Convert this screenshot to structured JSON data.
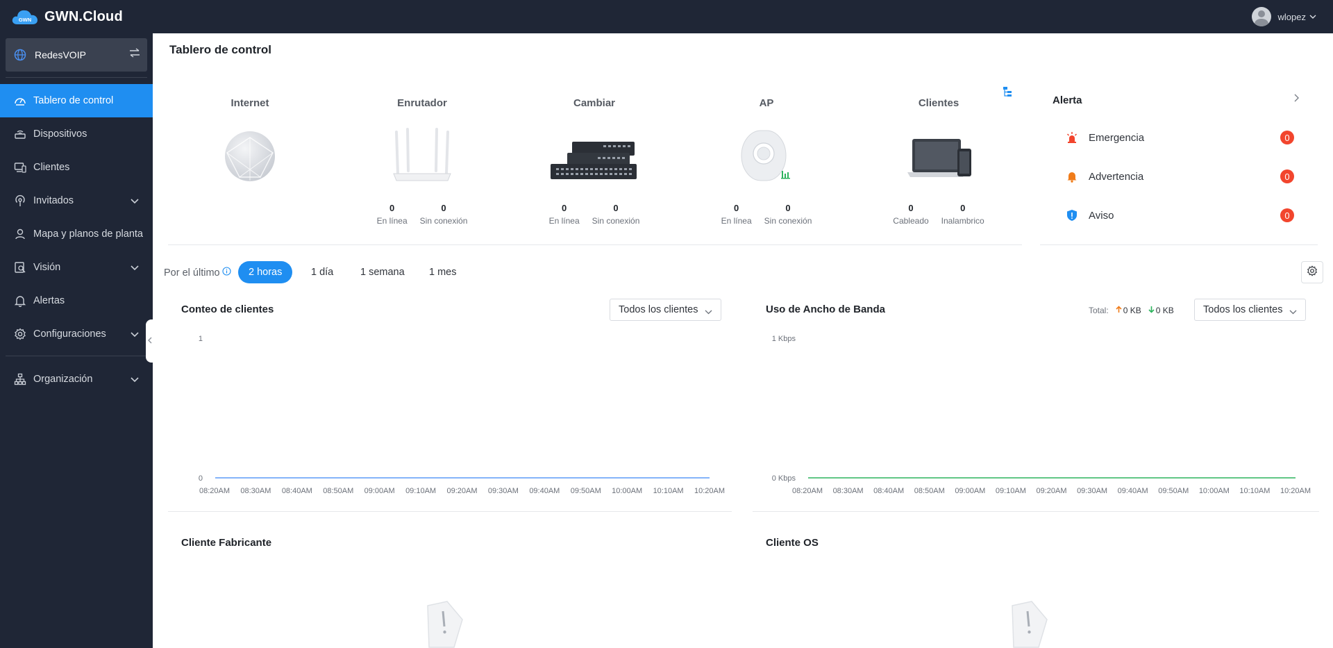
{
  "app": {
    "brand_name": "GWN.Cloud",
    "logo_text": "GWN"
  },
  "user": {
    "name": "wlopez"
  },
  "sidebar": {
    "network": "RedesVOIP",
    "items": [
      {
        "label": "Tablero de control",
        "icon": "dashboard-icon",
        "active": true
      },
      {
        "label": "Dispositivos",
        "icon": "router-icon"
      },
      {
        "label": "Clientes",
        "icon": "clients-icon"
      },
      {
        "label": "Invitados",
        "icon": "wifi-portal-icon",
        "expandable": true
      },
      {
        "label": "Mapa y planos de planta",
        "icon": "map-icon"
      },
      {
        "label": "Visión",
        "icon": "insight-icon",
        "expandable": true
      },
      {
        "label": "Alertas",
        "icon": "bell-icon"
      },
      {
        "label": "Configuraciones",
        "icon": "gear-icon",
        "expandable": true
      },
      {
        "label": "Organización",
        "icon": "organization-icon",
        "expandable": true
      }
    ]
  },
  "main": {
    "title": "Tablero de control",
    "devices": [
      {
        "title": "Internet",
        "stats": []
      },
      {
        "title": "Enrutador",
        "stats": [
          {
            "value": "0",
            "label": "En línea"
          },
          {
            "value": "0",
            "label": "Sin conexión"
          }
        ]
      },
      {
        "title": "Cambiar",
        "stats": [
          {
            "value": "0",
            "label": "En línea"
          },
          {
            "value": "0",
            "label": "Sin conexión"
          }
        ]
      },
      {
        "title": "AP",
        "stats": [
          {
            "value": "0",
            "label": "En línea"
          },
          {
            "value": "0",
            "label": "Sin conexión"
          }
        ]
      },
      {
        "title": "Clientes",
        "stats": [
          {
            "value": "0",
            "label": "Cableado"
          },
          {
            "value": "0",
            "label": "Inalambrico"
          }
        ]
      }
    ],
    "alerts": {
      "title": "Alerta",
      "items": [
        {
          "label": "Emergencia",
          "count": "0",
          "color": "#f2452d"
        },
        {
          "label": "Advertencia",
          "count": "0",
          "color": "#f07c1a"
        },
        {
          "label": "Aviso",
          "count": "0",
          "color": "#1f8ef1"
        }
      ]
    },
    "time_filter": {
      "label": "Por el último",
      "options": [
        "2 horas",
        "1 día",
        "1 semana",
        "1 mes"
      ],
      "selected": "2 horas"
    },
    "client_count": {
      "title": "Conteo de clientes",
      "filter": "Todos los clientes"
    },
    "bandwidth": {
      "title": "Uso de Ancho de Banda",
      "total_label": "Total:",
      "upload": "0 KB",
      "download": "0 KB",
      "filter": "Todos los clientes"
    },
    "manufacturer": {
      "title": "Cliente Fabricante"
    },
    "client_os": {
      "title": "Cliente OS"
    }
  },
  "chart_data": [
    {
      "type": "line",
      "title": "Conteo de clientes",
      "x": [
        "08:20AM",
        "08:30AM",
        "08:40AM",
        "08:50AM",
        "09:00AM",
        "09:10AM",
        "09:20AM",
        "09:30AM",
        "09:40AM",
        "09:50AM",
        "10:00AM",
        "10:10AM",
        "10:20AM"
      ],
      "y_ticks": [
        "1",
        "0"
      ],
      "ylim": [
        0,
        1
      ],
      "series": [
        {
          "values": [
            0,
            0,
            0,
            0,
            0,
            0,
            0,
            0,
            0,
            0,
            0,
            0,
            0
          ],
          "color": "#5b9bf8"
        }
      ]
    },
    {
      "type": "line",
      "title": "Uso de Ancho de Banda",
      "x": [
        "08:20AM",
        "08:30AM",
        "08:40AM",
        "08:50AM",
        "09:00AM",
        "09:10AM",
        "09:20AM",
        "09:30AM",
        "09:40AM",
        "09:50AM",
        "10:00AM",
        "10:10AM",
        "10:20AM"
      ],
      "y_ticks": [
        "1 Kbps",
        "0 Kbps"
      ],
      "ylim": [
        0,
        1
      ],
      "series": [
        {
          "values": [
            0,
            0,
            0,
            0,
            0,
            0,
            0,
            0,
            0,
            0,
            0,
            0,
            0
          ],
          "color": "#2db35d"
        }
      ]
    }
  ]
}
